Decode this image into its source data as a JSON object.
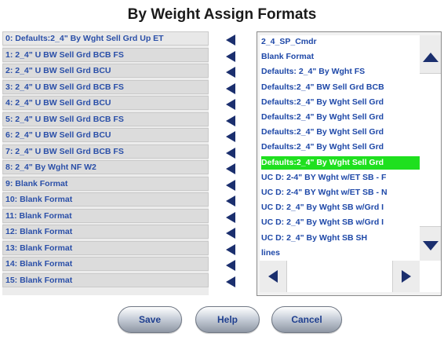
{
  "title": "By Weight Assign Formats",
  "slots": [
    "0: Defaults:2_4\" By Wght Sell Grd Up ET",
    "1: 2_4\" U BW Sell Grd BCB FS",
    "2: 2_4\" U BW Sell Grd BCU",
    "3: 2_4\" U BW Sell Grd BCB FS",
    "4: 2_4\" U BW Sell Grd BCU",
    "5: 2_4\" U BW Sell Grd BCB FS",
    "6: 2_4\" U BW Sell Grd BCU",
    "7: 2_4\" U BW Sell Grd BCB FS",
    "8: 2_4\"  By Wght NF W2",
    "9: Blank Format",
    "10: Blank Format",
    "11: Blank Format",
    "12: Blank Format",
    "13: Blank Format",
    "14: Blank Format",
    "15: Blank Format"
  ],
  "formats": [
    "2_4_SP_Cmdr",
    "Blank Format",
    "Defaults: 2_4\" By Wght FS",
    "Defaults:2_4\" BW Sell Grd BCB",
    "Defaults:2_4\" By Wght Sell Grd",
    "Defaults:2_4\" By Wght Sell Grd",
    "Defaults:2_4\" By Wght Sell Grd",
    "Defaults:2_4\" By Wght Sell Grd",
    "Defaults:2_4\" By Wght Sell Grd",
    "UC D: 2-4\" BY Wght w/ET SB - F",
    "UC D: 2-4\" BY Wght w/ET SB - N",
    "UC D: 2_4\"  By Wght SB w/Grd I",
    "UC D: 2_4\"  By Wght SB w/Grd I",
    "UC D: 2_4\" By Wght SB SH",
    "lines"
  ],
  "selected_format_index": 8,
  "buttons": {
    "save": "Save",
    "help": "Help",
    "cancel": "Cancel"
  },
  "colors": {
    "slot_text": "#2a4fa8",
    "format_text": "#1e48a8",
    "selected_bg": "#1fe01f",
    "arrow": "#1b2f6e"
  }
}
